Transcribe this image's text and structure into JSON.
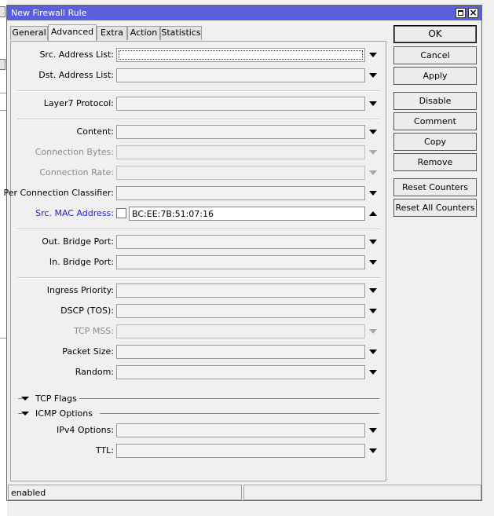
{
  "window": {
    "title": "New Firewall Rule"
  },
  "tabs": [
    "General",
    "Advanced",
    "Extra",
    "Action",
    "Statistics"
  ],
  "active_tab": "Advanced",
  "fields": {
    "src_address_list": {
      "label": "Src. Address List:",
      "value": ""
    },
    "dst_address_list": {
      "label": "Dst. Address List:",
      "value": ""
    },
    "layer7_protocol": {
      "label": "Layer7 Protocol:",
      "value": ""
    },
    "content": {
      "label": "Content:",
      "value": ""
    },
    "connection_bytes": {
      "label": "Connection Bytes:",
      "value": ""
    },
    "connection_rate": {
      "label": "Connection Rate:",
      "value": ""
    },
    "per_connection_classifier": {
      "label": "Per Connection Classifier:",
      "value": ""
    },
    "src_mac_address": {
      "label": "Src. MAC Address:",
      "value": "BC:EE:7B:51:07:16",
      "negate": false
    },
    "out_bridge_port": {
      "label": "Out. Bridge Port:",
      "value": ""
    },
    "in_bridge_port": {
      "label": "In. Bridge Port:",
      "value": ""
    },
    "ingress_priority": {
      "label": "Ingress Priority:",
      "value": ""
    },
    "dscp_tos": {
      "label": "DSCP (TOS):",
      "value": ""
    },
    "tcp_mss": {
      "label": "TCP MSS:",
      "value": ""
    },
    "packet_size": {
      "label": "Packet Size:",
      "value": ""
    },
    "random": {
      "label": "Random:",
      "value": ""
    },
    "ipv4_options": {
      "label": "IPv4 Options:",
      "value": ""
    },
    "ttl": {
      "label": "TTL:",
      "value": ""
    }
  },
  "sections": {
    "tcp_flags": "TCP Flags",
    "icmp_options": "ICMP Options"
  },
  "buttons": {
    "ok": "OK",
    "cancel": "Cancel",
    "apply": "Apply",
    "disable": "Disable",
    "comment": "Comment",
    "copy": "Copy",
    "remove": "Remove",
    "reset_counters": "Reset Counters",
    "reset_all_counters": "Reset All Counters"
  },
  "status": {
    "state": "enabled",
    "extra": ""
  },
  "colors": {
    "titlebar": "#5a5fe0",
    "mac_label": "#1e1ec8",
    "disabled_text": "#8a8a8a"
  }
}
